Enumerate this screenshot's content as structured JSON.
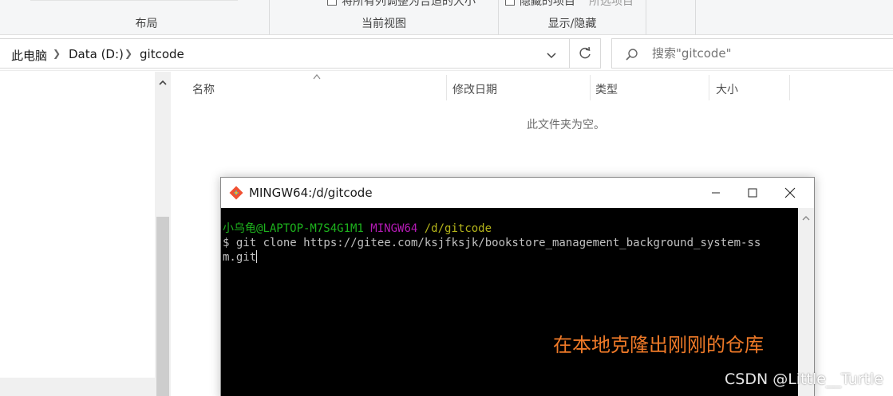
{
  "ribbon": {
    "groups": [
      {
        "label": "布局"
      },
      {
        "label": "当前视图"
      },
      {
        "label": "显示/隐藏"
      }
    ],
    "cut_text_1": "将所有列调整为合适的大小",
    "cut_text_2": "隐藏的项目",
    "cut_text_3": "所选项目"
  },
  "addressbar": {
    "crumbs": [
      "此电脑",
      "Data (D:)",
      "gitcode"
    ],
    "search_placeholder": "搜索\"gitcode\""
  },
  "filelist": {
    "columns": [
      "名称",
      "修改日期",
      "类型",
      "大小"
    ],
    "empty_message": "此文件夹为空。"
  },
  "terminal": {
    "title": "MINGW64:/d/gitcode",
    "prompt_user": "小乌龟@LAPTOP-M7S4G1M1",
    "prompt_system": "MINGW64",
    "prompt_path": "/d/gitcode",
    "command_line_1": "$ git clone https://gitee.com/ksjfksjk/bookstore_management_background_system-ss",
    "command_line_2": "m.git",
    "annotation": "在本地克隆出刚刚的仓库"
  },
  "watermark": "CSDN @Little__Turtle",
  "icons": {
    "git": "git-logo-icon",
    "minimize": "minimize-icon",
    "maximize": "maximize-icon",
    "close": "close-icon",
    "refresh": "refresh-icon",
    "search": "search-icon",
    "dropdown": "chevron-down-icon"
  },
  "colors": {
    "prompt_user": "#1db31d",
    "prompt_system": "#b51ab5",
    "prompt_path": "#b5b51a",
    "annotation": "#f07a28",
    "terminal_bg": "#000000"
  }
}
